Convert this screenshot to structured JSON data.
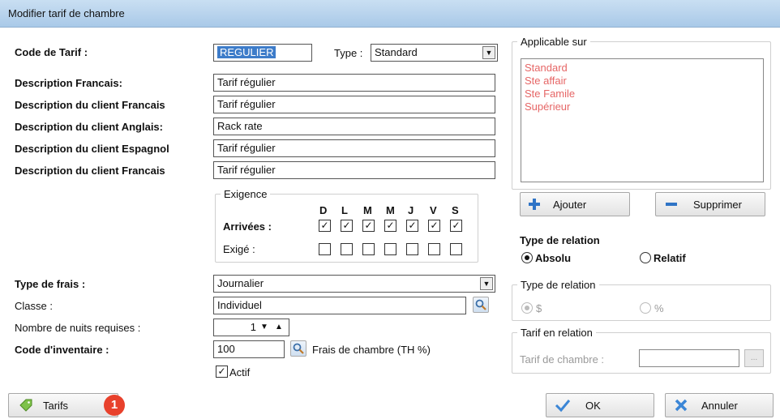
{
  "window": {
    "title": "Modifier tarif de chambre"
  },
  "form": {
    "code_label": "Code de Tarif :",
    "code_value": "REGULIER",
    "type_label": "Type :",
    "type_value": "Standard",
    "descriptions": [
      {
        "label": "Description Francais:",
        "value": "Tarif régulier"
      },
      {
        "label": "Description du client Francais",
        "value": "Tarif régulier"
      },
      {
        "label": "Description du client Anglais:",
        "value": "Rack rate"
      },
      {
        "label": "Description du client Espagnol",
        "value": "Tarif régulier"
      },
      {
        "label": "Description du client Francais",
        "value": "Tarif régulier"
      }
    ],
    "exigence": {
      "legend": "Exigence",
      "days": [
        "D",
        "L",
        "M",
        "M",
        "J",
        "V",
        "S"
      ],
      "arrivees_label": "Arrivées :",
      "arrivees": [
        true,
        true,
        true,
        true,
        true,
        true,
        true
      ],
      "exige_label": "Exigé :",
      "exige": [
        false,
        false,
        false,
        false,
        false,
        false,
        false
      ]
    },
    "type_frais_label": "Type de frais :",
    "type_frais_value": "Journalier",
    "classe_label": "Classe :",
    "classe_value": "Individuel",
    "nuits_label": "Nombre de nuits requises :",
    "nuits_value": "1",
    "inventaire_label": "Code d'inventaire :",
    "inventaire_value": "100",
    "frais_chambre_label": "Frais de chambre (TH %)",
    "actif_label": "Actif",
    "actif_checked": true
  },
  "applicable": {
    "legend": "Applicable sur",
    "items": [
      "Standard",
      "Ste affair",
      "Ste Famile",
      "Supérieur"
    ],
    "add_label": "Ajouter",
    "remove_label": "Supprimer"
  },
  "relation1": {
    "title": "Type de relation",
    "option1": "Absolu",
    "option2": "Relatif",
    "selected": "Absolu"
  },
  "relation2": {
    "legend": "Type de relation",
    "option1": "$",
    "option2": "%"
  },
  "tarif_relation": {
    "legend": "Tarif en relation",
    "label": "Tarif de chambre :"
  },
  "footer": {
    "tarifs_label": "Tarifs",
    "badge": "1",
    "ok_label": "OK",
    "cancel_label": "Annuler"
  },
  "colors": {
    "title_bar": "#b9d4ee",
    "list_item_text": "#e66666",
    "selection": "#3d7cc9",
    "badge": "#e8412c"
  }
}
